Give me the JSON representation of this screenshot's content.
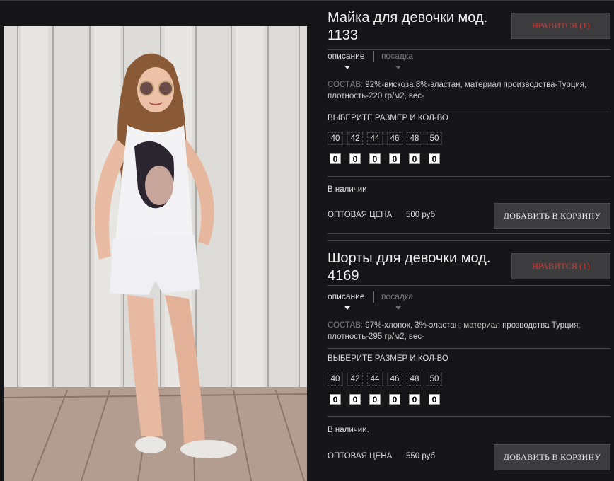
{
  "photo": {
    "alt": ""
  },
  "products": [
    {
      "title_line1": "Майка для девочки мод.",
      "title_line2": "1133",
      "like_label": "НРАВИТСЯ (1)",
      "tab_description": "описание",
      "tab_fit": "посадка",
      "composition_key": "СОСТАВ:",
      "composition_text": " 92%-вискоза,8%-эластан, материал производства-Турция, плотность-220 гр/м2, вес-",
      "choose_label": "ВЫБЕРИТЕ РАЗМЕР И КОЛ-ВО",
      "sizes": [
        "40",
        "42",
        "44",
        "46",
        "48",
        "50"
      ],
      "quantities": [
        "0",
        "0",
        "0",
        "0",
        "0",
        "0"
      ],
      "stock": "В наличии",
      "price_label": "ОПТОВАЯ ЦЕНА",
      "price_value": "500 руб",
      "cart_label": "ДОБАВИТЬ В КОРЗИНУ"
    },
    {
      "title_line1": "Шорты для девочки мод.",
      "title_line2": "4169",
      "like_label": "НРАВИТСЯ (1)",
      "tab_description": "описание",
      "tab_fit": "посадка",
      "composition_key": "СОСТАВ:",
      "composition_text": " 97%-хлопок, 3%-эластан; материал прозводства Турция; плотность-295 гр/м2, вес-",
      "choose_label": "ВЫБЕРИТЕ РАЗМЕР И КОЛ-ВО",
      "sizes": [
        "40",
        "42",
        "44",
        "46",
        "48",
        "50"
      ],
      "quantities": [
        "0",
        "0",
        "0",
        "0",
        "0",
        "0"
      ],
      "stock": "В наличии.",
      "price_label": "ОПТОВАЯ ЦЕНА",
      "price_value": "550 руб",
      "cart_label": "ДОБАВИТЬ В КОРЗИНУ"
    }
  ],
  "colors": {
    "background": "#161518",
    "button": "#3c3b3e",
    "like_text": "#d33b32"
  }
}
